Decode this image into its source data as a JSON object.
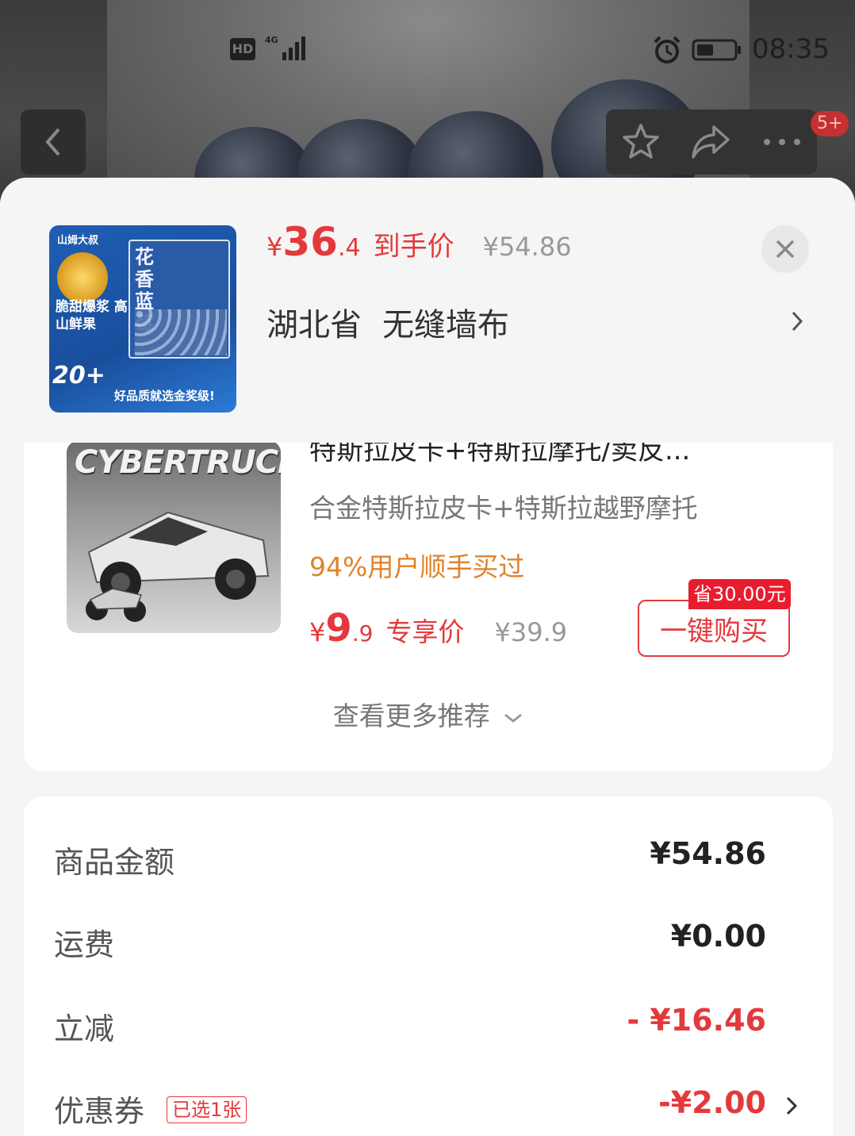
{
  "status_bar": {
    "hd": "HD",
    "network": "4G",
    "time": "08:35"
  },
  "nav": {
    "badge": "5+",
    "icons": [
      "back-icon",
      "star-icon",
      "share-icon",
      "more-icon"
    ]
  },
  "product": {
    "thumb": {
      "brand": "山姆大叔",
      "title": "花香蓝莓",
      "tagline": "脆甜爆浆 高山鲜果",
      "size": "20+",
      "footer": "好品质就选金奖级!"
    },
    "price_yen": "¥",
    "price_int": "36",
    "price_dec": ".4",
    "price_label": "到手价",
    "original_price": "¥54.86"
  },
  "address": {
    "province": "湖北省",
    "detail": "无缝墙布"
  },
  "recommend": {
    "image_title": "CYBERTRUCK",
    "title": "特斯拉皮卡+特斯拉摩托/卖反...",
    "subtitle": "合金特斯拉皮卡+特斯拉越野摩托",
    "tag": "94%用户顺手买过",
    "price_yen": "¥",
    "price_int": "9",
    "price_dec": ".9",
    "price_label": "专享价",
    "original_price": "¥39.9",
    "save_tag": "省30.00元",
    "buy_label": "一键购买",
    "more_label": "查看更多推荐"
  },
  "summary": {
    "rows": [
      {
        "label": "商品金额",
        "value": "¥54.86"
      },
      {
        "label": "运费",
        "value": "¥0.00"
      },
      {
        "label": "立减",
        "value": "- ¥16.46"
      },
      {
        "label": "优惠券",
        "value": "-¥2.00",
        "tag": "已选1张"
      }
    ]
  },
  "colors": {
    "accent_red": "#e4393c",
    "tag_orange": "#e0822a"
  }
}
